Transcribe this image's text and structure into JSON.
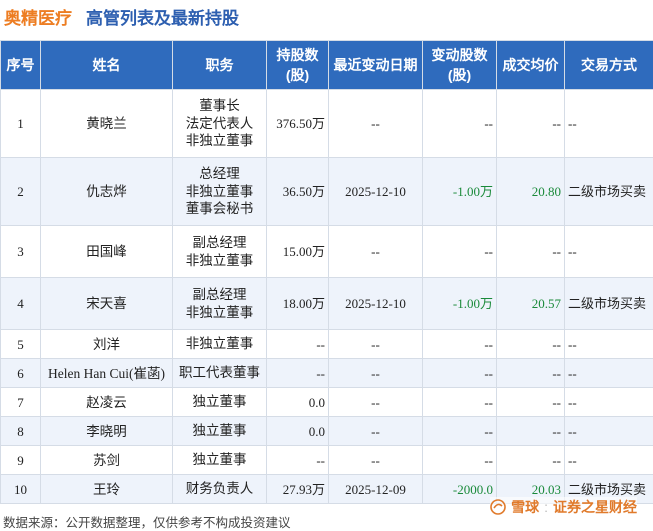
{
  "header": {
    "company": "奥精医疗",
    "subtitle": "高管列表及最新持股"
  },
  "table": {
    "columns": [
      "序号",
      "姓名",
      "职务",
      "持股数\n(股)",
      "最近变动日期",
      "变动股数\n(股)",
      "成交均价",
      "交易方式"
    ],
    "rows": [
      {
        "no": "1",
        "name": "黄晓兰",
        "positions": [
          "董事长",
          "法定代表人",
          "非独立董事"
        ],
        "shares": "376.50万",
        "date": "--",
        "change": "--",
        "price": "--",
        "method": "--"
      },
      {
        "no": "2",
        "name": "仇志烨",
        "positions": [
          "总经理",
          "非独立董事",
          "董事会秘书"
        ],
        "shares": "36.50万",
        "date": "2025-12-10",
        "change": "-1.00万",
        "price": "20.80",
        "method": "二级市场买卖"
      },
      {
        "no": "3",
        "name": "田国峰",
        "positions": [
          "副总经理",
          "非独立董事"
        ],
        "shares": "15.00万",
        "date": "--",
        "change": "--",
        "price": "--",
        "method": "--"
      },
      {
        "no": "4",
        "name": "宋天喜",
        "positions": [
          "副总经理",
          "非独立董事"
        ],
        "shares": "18.00万",
        "date": "2025-12-10",
        "change": "-1.00万",
        "price": "20.57",
        "method": "二级市场买卖"
      },
      {
        "no": "5",
        "name": "刘洋",
        "positions": [
          "非独立董事"
        ],
        "shares": "--",
        "date": "--",
        "change": "--",
        "price": "--",
        "method": "--"
      },
      {
        "no": "6",
        "name": "Helen Han Cui(崔菡)",
        "positions": [
          "职工代表董事"
        ],
        "shares": "--",
        "date": "--",
        "change": "--",
        "price": "--",
        "method": "--"
      },
      {
        "no": "7",
        "name": "赵凌云",
        "positions": [
          "独立董事"
        ],
        "shares": "0.0",
        "date": "--",
        "change": "--",
        "price": "--",
        "method": "--"
      },
      {
        "no": "8",
        "name": "李晓明",
        "positions": [
          "独立董事"
        ],
        "shares": "0.0",
        "date": "--",
        "change": "--",
        "price": "--",
        "method": "--"
      },
      {
        "no": "9",
        "name": "苏剑",
        "positions": [
          "独立董事"
        ],
        "shares": "--",
        "date": "--",
        "change": "--",
        "price": "--",
        "method": "--"
      },
      {
        "no": "10",
        "name": "王玲",
        "positions": [
          "财务负责人"
        ],
        "shares": "27.93万",
        "date": "2025-12-09",
        "change": "-2000.0",
        "price": "20.03",
        "method": "二级市场买卖"
      }
    ]
  },
  "footer": {
    "source": "数据来源：公开数据整理，仅供参考不构成投资建议",
    "brand_left": "雪球",
    "brand_right": "证券之星财经"
  },
  "colors": {
    "company": "#ed7d22",
    "subtitle": "#2d5fb0",
    "header_bg": "#2f6bbd",
    "stripe": "#eef3fb",
    "positive_value": "#1a8a3a"
  }
}
